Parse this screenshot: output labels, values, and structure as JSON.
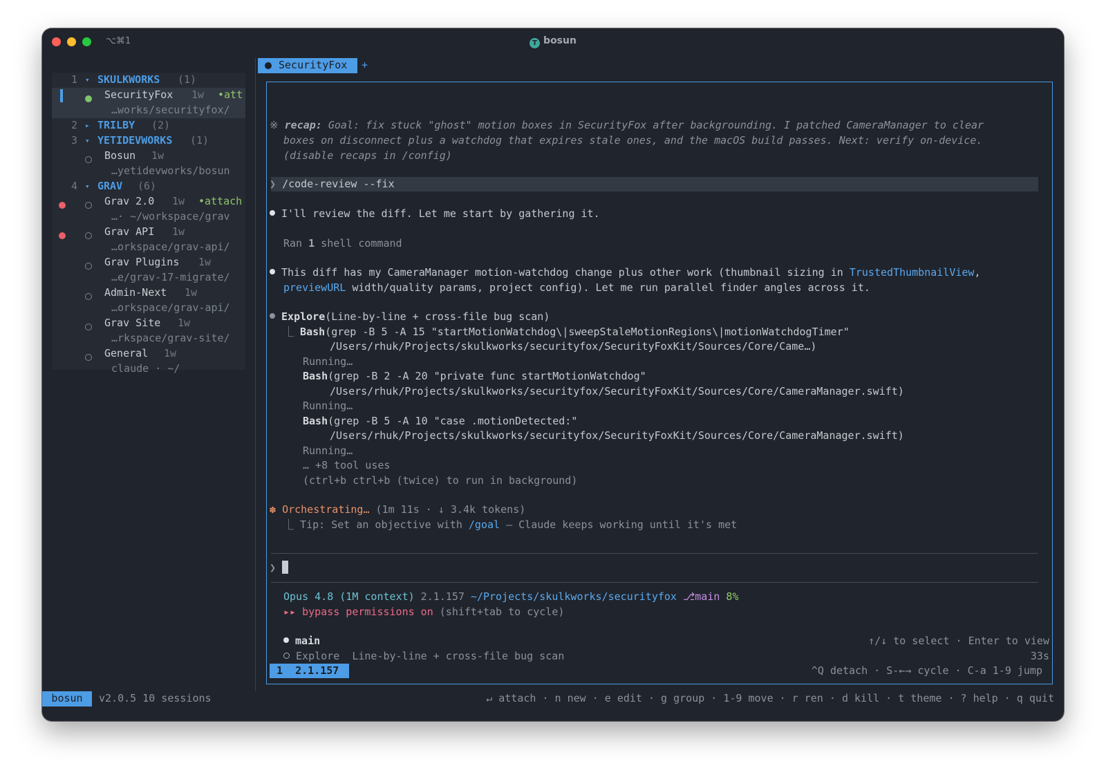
{
  "window": {
    "shortcut": "⌥⌘1",
    "title": "bosun",
    "title_icon": "T"
  },
  "sidebar": {
    "rows": [
      {
        "num": "1",
        "arrow": "▾",
        "group": "SKULKWORKS",
        "count": "(1)"
      },
      {
        "name": "SecurityFox",
        "age": "1w",
        "tag": "•att"
      },
      {
        "path": "…works/securityfox/"
      },
      {
        "num": "2",
        "arrow": "▸",
        "group": "TRILBY",
        "count": "(2)"
      },
      {
        "num": "3",
        "arrow": "▾",
        "group": "YETIDEVWORKS",
        "count": "(1)"
      },
      {
        "name": "Bosun",
        "age": "1w"
      },
      {
        "path": "…yetidevworks/bosun"
      },
      {
        "num": "4",
        "arrow": "▾",
        "group": "GRAV",
        "count": "(6)"
      },
      {
        "name": "Grav 2.0",
        "age": "1w",
        "tag": "•attach"
      },
      {
        "path": "…· ~/workspace/grav"
      },
      {
        "name": "Grav API",
        "age": "1w"
      },
      {
        "path": "…orkspace/grav-api/"
      },
      {
        "name": "Grav Plugins",
        "age": "1w"
      },
      {
        "path": "…e/grav-17-migrate/"
      },
      {
        "name": "Admin-Next",
        "age": "1w"
      },
      {
        "path": "…orkspace/grav-api/"
      },
      {
        "name": "Grav Site",
        "age": "1w"
      },
      {
        "path": "…rkspace/grav-site/"
      },
      {
        "name": "General",
        "age": "1w"
      },
      {
        "path": "claude · ~/"
      }
    ]
  },
  "tabs": {
    "active": "SecurityFox",
    "add": "+"
  },
  "terminal": {
    "recap_symbol": "※",
    "recap_label": "recap:",
    "recap_line1": " Goal: fix stuck \"ghost\" motion boxes in SecurityFox after backgrounding. I patched CameraManager to clear",
    "recap_line2": "boxes on disconnect plus a watchdog that expires stale ones, and the macOS build passes. Next: verify on-device.",
    "recap_line3": "(disable recaps in /config)",
    "prompt_symbol": "❯",
    "command": "/code-review --fix",
    "msg1": "I'll review the diff. Let me start by gathering it.",
    "ran_pre": "Ran ",
    "ran_num": "1",
    "ran_post": " shell command",
    "msg2_pre": "This diff has my CameraManager motion-watchdog change plus other work (thumbnail sizing in ",
    "msg2_link1": "TrustedThumbnailView",
    "msg2_comma": ",",
    "msg2_link2": "previewURL",
    "msg2_post": " width/quality params, project config). Let me run parallel finder angles across it.",
    "explore_name": "Explore",
    "explore_args": "(Line-by-line + cross-file bug scan)",
    "tree_corner": "⎿",
    "bash_label": "Bash",
    "bash1_args": "(grep -B 5 -A 15 \"startMotionWatchdog\\|sweepStaleMotionRegions\\|motionWatchdogTimer\"",
    "bash1_path": "/Users/rhuk/Projects/skulkworks/securityfox/SecurityFoxKit/Sources/Core/Came…)",
    "running": "Running…",
    "bash2_args": "(grep -B 2 -A 20 \"private func startMotionWatchdog\"",
    "bash2_path": "/Users/rhuk/Projects/skulkworks/securityfox/SecurityFoxKit/Sources/Core/CameraManager.swift)",
    "bash3_args": "(grep -B 5 -A 10 \"case .motionDetected:\"",
    "bash3_path": "/Users/rhuk/Projects/skulkworks/securityfox/SecurityFoxKit/Sources/Core/CameraManager.swift)",
    "more_tools": "… +8 tool uses",
    "bg_hint": "(ctrl+b ctrl+b (twice) to run in background)",
    "orch_symbol": "✽",
    "orch_label": "Orchestrating…",
    "orch_stats": " (1m 11s · ↓ 3.4k tokens)",
    "tip_pre": "Tip: Set an objective with ",
    "tip_goal": "/goal",
    "tip_post": " — Claude keeps working until it's met",
    "status_model": "Opus 4.8 (1M context)",
    "status_ver": " 2.1.157 ",
    "status_path": "~/Projects/skulkworks/securityfox",
    "status_branch": " ⎇main",
    "status_pct": " 8%",
    "perm_arrows": "▸▸",
    "perm_label": " bypass permissions on",
    "perm_hint": " (shift+tab to cycle)",
    "agent_main": "main",
    "agent_hint": "↑/↓ to select · Enter to view",
    "agent_explore": "Explore",
    "agent_explore_desc": "Line-by-line + cross-file bug scan",
    "agent_time": "33s",
    "badge": "1  2.1.157",
    "keys_hint": "^Q detach · S-←→ cycle · C-a 1-9 jump"
  },
  "statusbar": {
    "badge": "bosun",
    "info": "v2.0.5 10 sessions",
    "hints": "↵ attach · n new · e edit · g group · 1-9 move · r ren · d kill · t theme · ? help · q quit"
  },
  "colors": {
    "accent": "#4d9ce6",
    "background": "#20242c",
    "red_dot": "#ea5f6a",
    "green_dot": "#7ec46a"
  }
}
